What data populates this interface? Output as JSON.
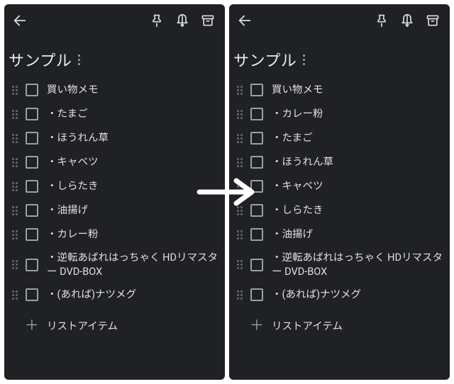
{
  "panels": [
    {
      "title": "サンプル",
      "items": [
        "買い物メモ",
        "・たまご",
        "・ほうれん草",
        "・キャベツ",
        "・しらたき",
        "・油揚げ",
        "・カレー粉",
        "・逆転あばれはっちゃく HDリマスター DVD-BOX",
        "・(あれば)ナツメグ"
      ],
      "add_label": "リストアイテム"
    },
    {
      "title": "サンプル",
      "items": [
        "買い物メモ",
        "・カレー粉",
        "・たまご",
        "・ほうれん草",
        "・キャベツ",
        "・しらたき",
        "・油揚げ",
        "・逆転あばれはっちゃく HDリマスター DVD-BOX",
        "・(あれば)ナツメグ"
      ],
      "add_label": "リストアイテム"
    }
  ],
  "icons": {
    "back": "back-arrow-icon",
    "pin": "pin-icon",
    "reminder": "bell-icon",
    "archive": "archive-icon",
    "more": "more-vert-icon",
    "drag": "drag-handle-icon",
    "checkbox": "checkbox-empty-icon",
    "plus": "plus-icon",
    "transition": "right-arrow-icon"
  },
  "colors": {
    "panel_bg": "#202124",
    "text": "#e8eaed",
    "muted": "#9aa0a6",
    "handle": "#5f6368"
  }
}
